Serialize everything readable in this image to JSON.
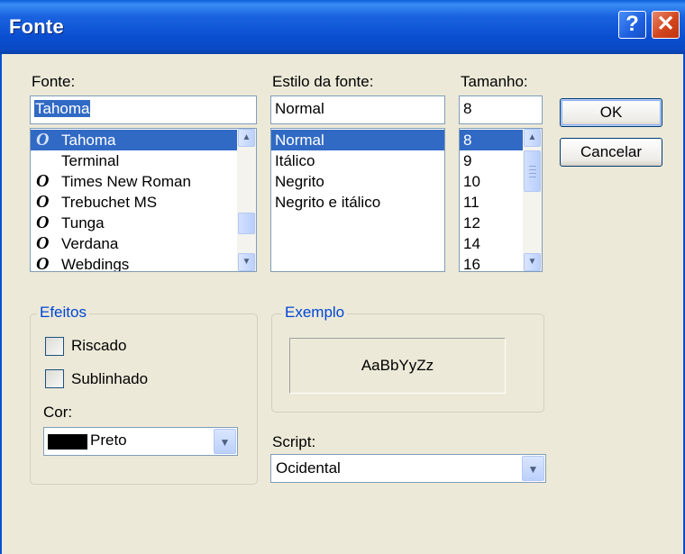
{
  "window": {
    "title": "Fonte",
    "help_glyph": "?",
    "close_glyph": "✕"
  },
  "font": {
    "label": "Fonte:",
    "value": "Tahoma",
    "items": [
      {
        "name": "Tahoma",
        "icon": "opentype-font-icon"
      },
      {
        "name": "Terminal",
        "icon": ""
      },
      {
        "name": "Times New Roman",
        "icon": "opentype-font-icon"
      },
      {
        "name": "Trebuchet MS",
        "icon": "opentype-font-icon"
      },
      {
        "name": "Tunga",
        "icon": "opentype-font-icon"
      },
      {
        "name": "Verdana",
        "icon": "opentype-font-icon"
      },
      {
        "name": "Webdings",
        "icon": "opentype-font-icon"
      }
    ],
    "icon_glyph": "O",
    "selected": "Tahoma"
  },
  "style": {
    "label": "Estilo da fonte:",
    "value": "Normal",
    "items": [
      "Normal",
      "Itálico",
      "Negrito",
      "Negrito e itálico"
    ],
    "selected": "Normal"
  },
  "size": {
    "label": "Tamanho:",
    "value": "8",
    "items": [
      "8",
      "9",
      "10",
      "11",
      "12",
      "14",
      "16"
    ],
    "selected": "8"
  },
  "buttons": {
    "ok": "OK",
    "cancel": "Cancelar"
  },
  "effects": {
    "title": "Efeitos",
    "strikeout": {
      "label": "Riscado",
      "checked": false
    },
    "underline": {
      "label": "Sublinhado",
      "checked": false
    },
    "color_label": "Cor:",
    "color_value": "Preto",
    "color_swatch": "#000000"
  },
  "sample": {
    "title": "Exemplo",
    "text": "AaBbYyZz"
  },
  "script": {
    "label": "Script:",
    "value": "Ocidental"
  },
  "colors": {
    "titlebar": "#0a4ed0",
    "selection": "#316ac5",
    "dialog_bg": "#ece9d8",
    "group_title": "#0046d5"
  }
}
